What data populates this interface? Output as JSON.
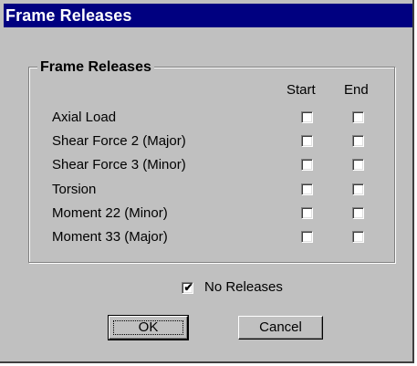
{
  "window": {
    "title": "Frame Releases"
  },
  "group": {
    "title": "Frame Releases",
    "columns": {
      "start": "Start",
      "end": "End"
    },
    "rows": [
      {
        "label": "Axial Load",
        "start": false,
        "end": false
      },
      {
        "label": "Shear Force 2 (Major)",
        "start": false,
        "end": false
      },
      {
        "label": "Shear Force 3 (Minor)",
        "start": false,
        "end": false
      },
      {
        "label": "Torsion",
        "start": false,
        "end": false
      },
      {
        "label": "Moment 22 (Minor)",
        "start": false,
        "end": false
      },
      {
        "label": "Moment 33 (Major)",
        "start": false,
        "end": false
      }
    ]
  },
  "no_releases": {
    "label": "No Releases",
    "checked": true
  },
  "buttons": {
    "ok": "OK",
    "cancel": "Cancel"
  }
}
